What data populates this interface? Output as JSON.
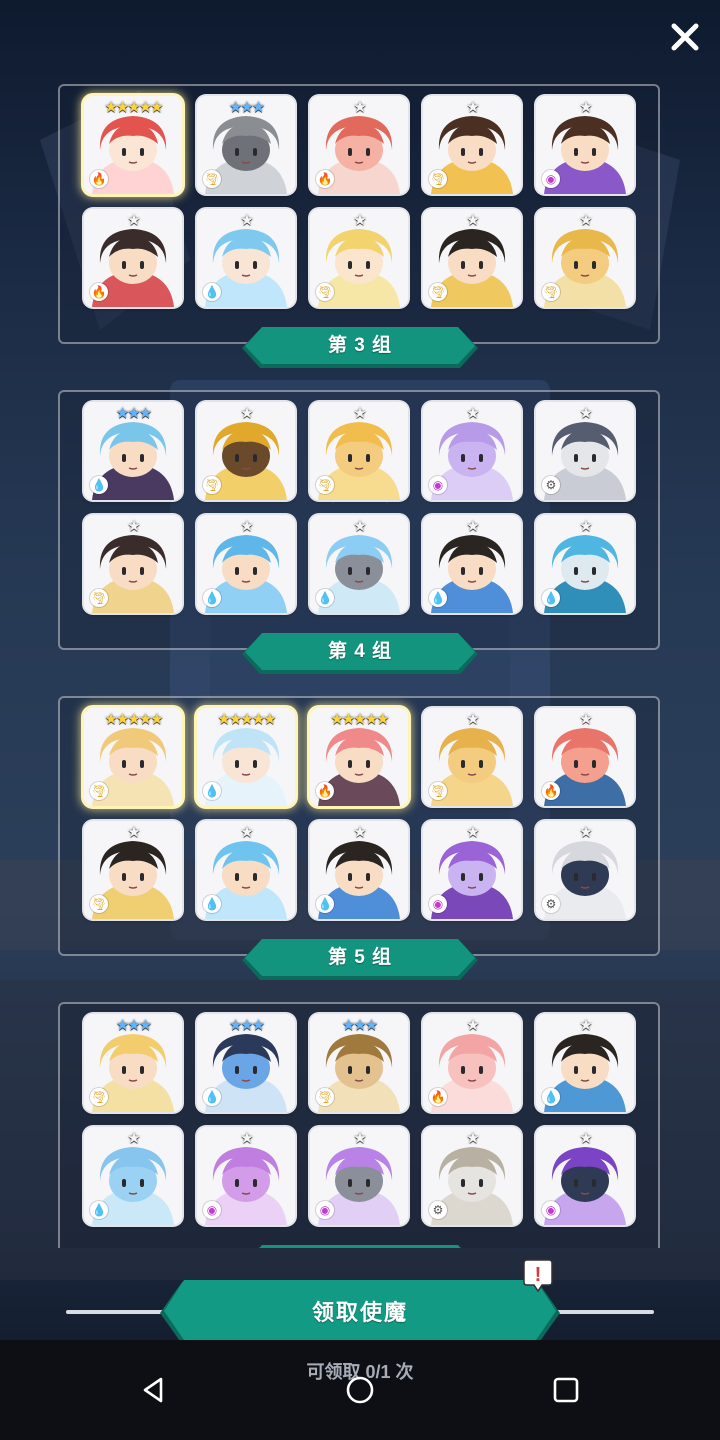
{
  "header": {
    "close_label": "✕"
  },
  "colors": {
    "ribbon_fill": "#12947f",
    "ribbon_dark": "#0b6a5b",
    "button_fill": "#139a84",
    "star_one": "#f6f6f6",
    "star_three": "#5fb4ff",
    "star_five": "#ffd43a"
  },
  "groups": [
    {
      "title": "",
      "cards": [
        {
          "stars": "★★★★★",
          "rarity": 5,
          "element": "fire",
          "element_icon": "🔥",
          "hair": "#e3544f",
          "skin": "#fbe6d6",
          "theme": "#ffd3d3"
        },
        {
          "stars": "★★★",
          "rarity": 3,
          "element": "wind",
          "element_icon": "🌪",
          "hair": "#8a8d92",
          "skin": "#6e7278",
          "theme": "#cfd3d8"
        },
        {
          "stars": "★",
          "rarity": 1,
          "element": "fire",
          "element_icon": "🔥",
          "hair": "#e26a5c",
          "skin": "#f5b1a4",
          "theme": "#f7d6d0"
        },
        {
          "stars": "★",
          "rarity": 1,
          "element": "wind",
          "element_icon": "🌪",
          "hair": "#4a2f22",
          "skin": "#f8dcc4",
          "theme": "#f1c252"
        },
        {
          "stars": "★",
          "rarity": 1,
          "element": "arcane",
          "element_icon": "◉",
          "hair": "#4a2f22",
          "skin": "#f8dcc4",
          "theme": "#8a58c9"
        },
        {
          "stars": "★",
          "rarity": 1,
          "element": "fire",
          "element_icon": "🔥",
          "hair": "#3a2c2a",
          "skin": "#f8dcc4",
          "theme": "#d9565a"
        },
        {
          "stars": "★",
          "rarity": 1,
          "element": "water",
          "element_icon": "💧",
          "hair": "#7fc9ef",
          "skin": "#f8e5d6",
          "theme": "#bfe6fb"
        },
        {
          "stars": "★",
          "rarity": 1,
          "element": "wind",
          "element_icon": "🌪",
          "hair": "#f2d36d",
          "skin": "#fbe5cd",
          "theme": "#f7e7a6"
        },
        {
          "stars": "★",
          "rarity": 1,
          "element": "wind",
          "element_icon": "🌪",
          "hair": "#2b2522",
          "skin": "#f8dcc4",
          "theme": "#efc960"
        },
        {
          "stars": "★",
          "rarity": 1,
          "element": "wind",
          "element_icon": "🌪",
          "hair": "#e8b84a",
          "skin": "#f3cc80",
          "theme": "#f2e0a6"
        }
      ]
    },
    {
      "title": "第 3 组",
      "cards": [
        {
          "stars": "★★★",
          "rarity": 3,
          "element": "water",
          "element_icon": "💧",
          "hair": "#79c6ea",
          "skin": "#f8dcc4",
          "theme": "#4a3a62"
        },
        {
          "stars": "★",
          "rarity": 1,
          "element": "wind",
          "element_icon": "🌪",
          "hair": "#e0a92c",
          "skin": "#6b4a2c",
          "theme": "#f3cf6a"
        },
        {
          "stars": "★",
          "rarity": 1,
          "element": "wind",
          "element_icon": "🌪",
          "hair": "#f1bd4d",
          "skin": "#f3cc80",
          "theme": "#f7dc8f"
        },
        {
          "stars": "★",
          "rarity": 1,
          "element": "arcane",
          "element_icon": "◉",
          "hair": "#b79be9",
          "skin": "#c9b4f1",
          "theme": "#dccdf7"
        },
        {
          "stars": "★",
          "rarity": 1,
          "element": "machine",
          "element_icon": "⚙",
          "hair": "#565d70",
          "skin": "#e5e6ea",
          "theme": "#c9ccd4"
        },
        {
          "stars": "★",
          "rarity": 1,
          "element": "wind",
          "element_icon": "🌪",
          "hair": "#3a2c2a",
          "skin": "#f8dcc4",
          "theme": "#f0d38d"
        },
        {
          "stars": "★",
          "rarity": 1,
          "element": "water",
          "element_icon": "💧",
          "hair": "#5fb6e8",
          "skin": "#f8dcc4",
          "theme": "#8fd0f4"
        },
        {
          "stars": "★",
          "rarity": 1,
          "element": "water",
          "element_icon": "💧",
          "hair": "#8ccdf3",
          "skin": "#8a8f99",
          "theme": "#cfe9f7"
        },
        {
          "stars": "★",
          "rarity": 1,
          "element": "water",
          "element_icon": "💧",
          "hair": "#2b2522",
          "skin": "#f8dcc4",
          "theme": "#4f8fd9"
        },
        {
          "stars": "★",
          "rarity": 1,
          "element": "water",
          "element_icon": "💧",
          "hair": "#4eb6e0",
          "skin": "#dfe9f0",
          "theme": "#2f8fb8"
        }
      ]
    },
    {
      "title": "第 4 组",
      "cards": [
        {
          "stars": "★★★★★",
          "rarity": 5,
          "element": "wind",
          "element_icon": "🌪",
          "hair": "#f0c97a",
          "skin": "#f8dcc4",
          "theme": "#f5e3b4"
        },
        {
          "stars": "★★★★★",
          "rarity": 5,
          "element": "water",
          "element_icon": "💧",
          "hair": "#bfe3f7",
          "skin": "#f8e5d6",
          "theme": "#e7f3fb"
        },
        {
          "stars": "★★★★★",
          "rarity": 5,
          "element": "fire",
          "element_icon": "🔥",
          "hair": "#f08a8a",
          "skin": "#f8dcc4",
          "theme": "#6a4a5a"
        },
        {
          "stars": "★",
          "rarity": 1,
          "element": "wind",
          "element_icon": "🌪",
          "hair": "#e7b24b",
          "skin": "#f3cc80",
          "theme": "#f4d58a"
        },
        {
          "stars": "★",
          "rarity": 1,
          "element": "fire",
          "element_icon": "🔥",
          "hair": "#e8746a",
          "skin": "#f59f8f",
          "theme": "#3e6ea6"
        },
        {
          "stars": "★",
          "rarity": 1,
          "element": "wind",
          "element_icon": "🌪",
          "hair": "#2b2522",
          "skin": "#f8dcc4",
          "theme": "#efcf72"
        },
        {
          "stars": "★",
          "rarity": 1,
          "element": "water",
          "element_icon": "💧",
          "hair": "#6fc4ef",
          "skin": "#f8dcc4",
          "theme": "#bfe6fb"
        },
        {
          "stars": "★",
          "rarity": 1,
          "element": "water",
          "element_icon": "💧",
          "hair": "#2b2522",
          "skin": "#f8dcc4",
          "theme": "#4f8fd9"
        },
        {
          "stars": "★",
          "rarity": 1,
          "element": "arcane",
          "element_icon": "◉",
          "hair": "#9a63d6",
          "skin": "#c9b4f1",
          "theme": "#7a48b9"
        },
        {
          "stars": "★",
          "rarity": 1,
          "element": "machine",
          "element_icon": "⚙",
          "hair": "#d6d8dd",
          "skin": "#2f3a55",
          "theme": "#eaebef"
        }
      ]
    },
    {
      "title": "第 5 组",
      "cards": [
        {
          "stars": "★★★",
          "rarity": 3,
          "element": "wind",
          "element_icon": "🌪",
          "hair": "#f3cc6d",
          "skin": "#f8dcc4",
          "theme": "#f4e0a2"
        },
        {
          "stars": "★★★",
          "rarity": 3,
          "element": "water",
          "element_icon": "💧",
          "hair": "#2b3a5a",
          "skin": "#6aa6e6",
          "theme": "#cfe3f7"
        },
        {
          "stars": "★★★",
          "rarity": 3,
          "element": "wind",
          "element_icon": "🌪",
          "hair": "#a07a3d",
          "skin": "#e4c290",
          "theme": "#f2e1b8"
        },
        {
          "stars": "★",
          "rarity": 1,
          "element": "fire",
          "element_icon": "🔥",
          "hair": "#f3a5a5",
          "skin": "#f7c1bd",
          "theme": "#fbdcda"
        },
        {
          "stars": "★",
          "rarity": 1,
          "element": "water",
          "element_icon": "💧",
          "hair": "#2b2522",
          "skin": "#f8dcc4",
          "theme": "#4f98d6"
        },
        {
          "stars": "★",
          "rarity": 1,
          "element": "water",
          "element_icon": "💧",
          "hair": "#86c5ee",
          "skin": "#9bd2f3",
          "theme": "#cbe8f8"
        },
        {
          "stars": "★",
          "rarity": 1,
          "element": "arcane",
          "element_icon": "◉",
          "hair": "#c07ee0",
          "skin": "#d39ce9",
          "theme": "#ead1f5"
        },
        {
          "stars": "★",
          "rarity": 1,
          "element": "arcane",
          "element_icon": "◉",
          "hair": "#b982e6",
          "skin": "#8a8f99",
          "theme": "#e1cff5"
        },
        {
          "stars": "★",
          "rarity": 1,
          "element": "machine",
          "element_icon": "⚙",
          "hair": "#b8b0a2",
          "skin": "#e6e4e0",
          "theme": "#dcd7cf"
        },
        {
          "stars": "★",
          "rarity": 1,
          "element": "arcane",
          "element_icon": "◉",
          "hair": "#7b44c4",
          "skin": "#2f3a55",
          "theme": "#c7a6ee"
        }
      ]
    }
  ],
  "footer": {
    "claim_button_label": "领取使魔",
    "claim_count_text": "可领取 0/1 次",
    "alert_mark": "!"
  }
}
